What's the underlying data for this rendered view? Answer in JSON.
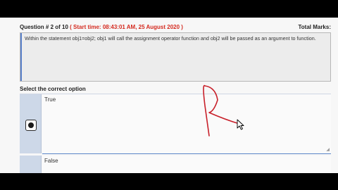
{
  "question": {
    "number_text": "Question # 2 of 10",
    "start_time_text": "( Start time: 08:43:01 AM, 25 August 2020 )",
    "total_marks_label": "Total Marks:",
    "body": "Within the statement obj1=obj2; obj1 will call the assignment operator function and obj2 will be passed as an argument to function."
  },
  "answer": {
    "select_label": "Select the correct option",
    "options": [
      {
        "label": "True",
        "selected": true
      },
      {
        "label": "False",
        "selected": false
      }
    ]
  },
  "colors": {
    "accent_red": "#d42a1f",
    "option_side": "#cdd8e8",
    "option_border": "#5b87c9",
    "annotation": "#c8202a"
  },
  "icons": {
    "resize_grip": "resize-grip-icon",
    "cursor": "mouse-pointer-icon"
  }
}
